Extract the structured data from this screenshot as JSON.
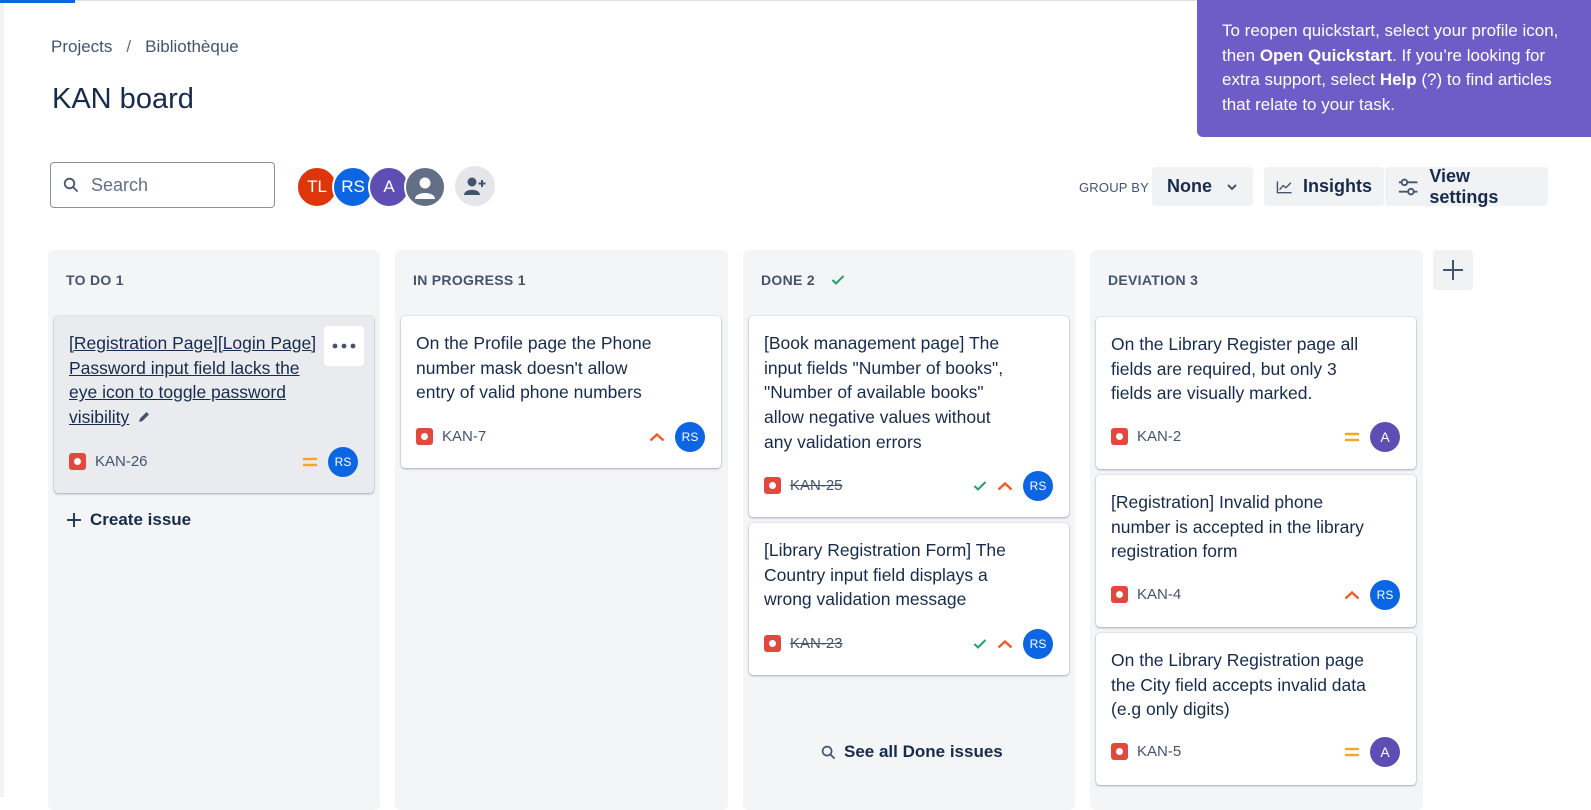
{
  "breadcrumb": {
    "projects": "Projects",
    "separator": "/",
    "project": "Bibliothèque"
  },
  "page_title": "KAN board",
  "search": {
    "placeholder": "Search"
  },
  "avatars": [
    {
      "initials": "TL",
      "color": "#de350b"
    },
    {
      "initials": "RS",
      "color": "#0c66e4"
    },
    {
      "initials": "A",
      "color": "#5e4db2"
    }
  ],
  "toolbar": {
    "group_by_label": "GROUP BY",
    "group_by_value": "None",
    "insights_label": "Insights",
    "view_settings_label": "View settings"
  },
  "columns": [
    {
      "title": "TO DO 1"
    },
    {
      "title": "IN PROGRESS 1"
    },
    {
      "title": "DONE 2"
    },
    {
      "title": "DEVIATION 3"
    }
  ],
  "cards": {
    "kan26": {
      "summary_l1": "[Registration Page][Login Page]",
      "summary_l2": "Password input field lacks the",
      "summary_l3": "eye icon to toggle password",
      "summary_l4": "visibility",
      "key": "KAN-26",
      "assignee": "RS"
    },
    "kan7": {
      "summary_l1": "On the Profile page the Phone",
      "summary_l2": "number mask doesn't allow",
      "summary_l3": "entry of valid phone numbers",
      "key": "KAN-7",
      "assignee": "RS"
    },
    "kan25": {
      "summary_l1": "[Book management page] The",
      "summary_l2": "input fields \"Number of books\",",
      "summary_l3": "\"Number of available books\"",
      "summary_l4": "allow negative values without",
      "summary_l5": "any validation errors",
      "key": "KAN-25",
      "assignee": "RS"
    },
    "kan23": {
      "summary_l1": "[Library Registration Form] The",
      "summary_l2": "Country input field displays a",
      "summary_l3": "wrong validation message",
      "key": "KAN-23",
      "assignee": "RS"
    },
    "kan2": {
      "summary_l1": "On the Library Register page all",
      "summary_l2": "fields are required, but only 3",
      "summary_l3": "fields are visually marked.",
      "key": "KAN-2",
      "assignee": "A"
    },
    "kan4": {
      "summary_l1": "[Registration] Invalid phone",
      "summary_l2": "number is accepted in the library",
      "summary_l3": "registration form",
      "key": "KAN-4",
      "assignee": "RS"
    },
    "kan5": {
      "summary_l1": "On the Library Registration page",
      "summary_l2": "the City field accepts invalid data",
      "summary_l3": "(e.g only digits)",
      "key": "KAN-5",
      "assignee": "A"
    }
  },
  "create_issue_label": "Create issue",
  "see_all_done_label": "See all Done issues",
  "tooltip": {
    "t1": "To reopen quickstart, select your profile icon,",
    "t2a": "then ",
    "t2b": "Open Quickstart",
    "t2c": ". If you’re looking for",
    "t3a": "extra support, select ",
    "t3b": "Help",
    "t3c": " (?) to find articles",
    "t4": "that relate to your task."
  },
  "colors": {
    "brand": "#0c66e4",
    "tooltip_bg": "#6e5dc6",
    "bug": "#e2483d",
    "priority_high": "#f15b2a",
    "priority_medium": "#f5a623",
    "done_check": "#22a06b"
  }
}
